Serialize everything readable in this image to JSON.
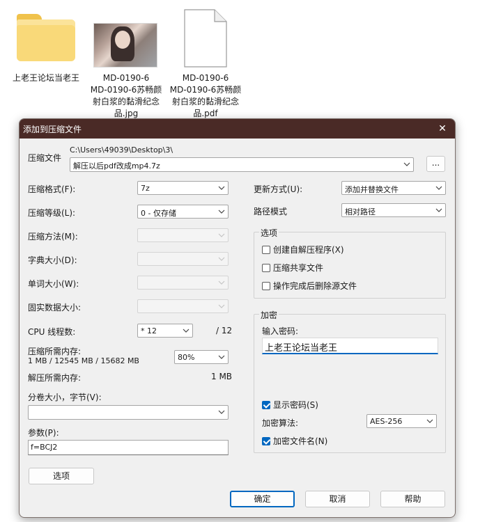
{
  "desktop": {
    "items": [
      {
        "label": "上老王论坛当老王"
      },
      {
        "label": "MD-0190-6\nMD-0190-6苏畅颜射白浆的黏滑纪念品.jpg"
      },
      {
        "label": "MD-0190-6\nMD-0190-6苏畅颜射白浆的黏滑纪念品.pdf"
      }
    ]
  },
  "dialog": {
    "title": "添加到压缩文件",
    "close": "✕",
    "archive": {
      "label": "压缩文件",
      "path": "C:\\Users\\49039\\Desktop\\3\\",
      "name": "解压以后pdf改成mp4.7z",
      "browse_label": "..."
    },
    "left": {
      "format_label": "压缩格式(F):",
      "format_value": "7z",
      "level_label": "压缩等级(L):",
      "level_value": "0 - 仅存储",
      "method_label": "压缩方法(M):",
      "dict_label": "字典大小(D):",
      "word_label": "单词大小(W):",
      "solid_label": "固实数据大小:",
      "cpu_label": "CPU 线程数:",
      "cpu_value": "* 12",
      "cpu_total": "/ 12",
      "mem_label": "压缩所需内存:",
      "mem_detail": "1 MB / 12545 MB / 15682 MB",
      "mem_value": "80%",
      "decomp_label": "解压所需内存:",
      "decomp_value": "1 MB",
      "split_label": "分卷大小，字节(V):",
      "split_value": "",
      "params_label": "参数(P):",
      "params_value": "f=BCJ2",
      "options_button": "选项"
    },
    "right": {
      "update_label": "更新方式(U):",
      "update_value": "添加并替换文件",
      "path_label": "路径模式",
      "path_value": "相对路径",
      "options_group": "选项",
      "opt_sfx": "创建自解压程序(X)",
      "opt_shared": "压缩共享文件",
      "opt_delete": "操作完成后删除源文件",
      "enc_group": "加密",
      "pwd_label": "输入密码:",
      "pwd_value": "上老王论坛当老王",
      "show_pwd": "显示密码(S)",
      "enc_method_label": "加密算法:",
      "enc_method_value": "AES-256",
      "enc_names": "加密文件名(N)"
    },
    "buttons": {
      "ok": "确定",
      "cancel": "取消",
      "help": "帮助"
    }
  },
  "colors": {
    "titlebar": "#4a2a26",
    "accent": "#0067c0"
  }
}
